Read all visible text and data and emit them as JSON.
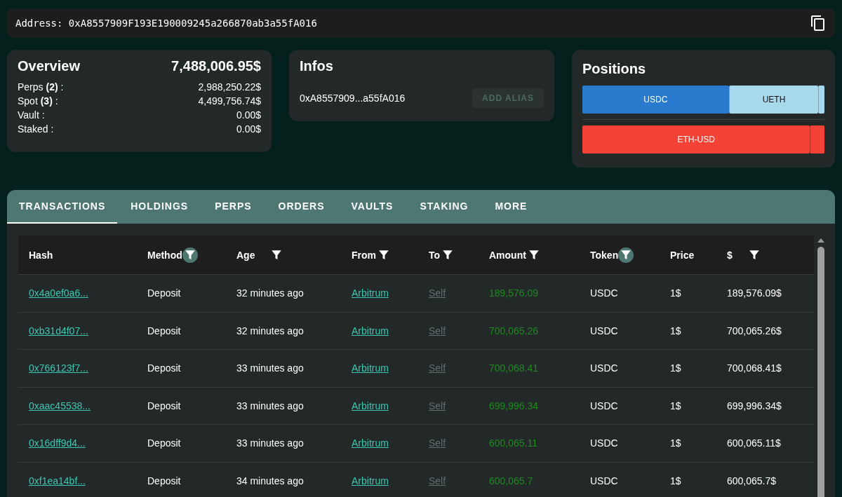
{
  "address_bar": {
    "label": "Address:",
    "value": "0xA8557909F193E190009245a266870ab3a55fA016"
  },
  "overview": {
    "title": "Overview",
    "total": "7,488,006.95$",
    "lines": [
      {
        "label": "Perps **(2)** :",
        "value": "2,988,250.22$"
      },
      {
        "label": "Spot **(3)** :",
        "value": "4,499,756.74$"
      },
      {
        "label": "Vault :",
        "value": "0.00$"
      },
      {
        "label": "Staked :",
        "value": "0.00$"
      }
    ]
  },
  "infos": {
    "title": "Infos",
    "address": "0xA8557909...a55fA016",
    "button": {
      "label": "ADD ALIAS",
      "disabled": true
    }
  },
  "positions": {
    "title": "Positions",
    "bars": [
      {
        "segments": [
          {
            "label": "USDC",
            "color": "#2979cc"
          },
          {
            "label": "UETH",
            "color": "#a8d8ec"
          },
          {
            "color": "#a8d8ec"
          }
        ]
      },
      {
        "segments": [
          {
            "label": "ETH-USD",
            "color": "#f44336"
          },
          {
            "color": "#f44336"
          }
        ]
      }
    ]
  },
  "tabs": [
    {
      "label": "TRANSACTIONS",
      "selected": true
    },
    {
      "label": "HOLDINGS",
      "selected": false
    },
    {
      "label": "PERPS",
      "selected": false
    },
    {
      "label": "ORDERS",
      "selected": false
    },
    {
      "label": "VAULTS",
      "selected": false
    },
    {
      "label": "STAKING",
      "selected": false
    },
    {
      "label": "MORE",
      "selected": false
    }
  ],
  "table": {
    "columns": [
      {
        "label": "Hash"
      },
      {
        "label": "Method",
        "filter": {
          "active": true
        }
      },
      {
        "label": "Age",
        "filter": {
          "active": false
        }
      },
      {
        "label": "From",
        "filter": {
          "active": false
        }
      },
      {
        "label": "To",
        "filter": {
          "active": false
        }
      },
      {
        "label": "Amount",
        "filter": {
          "active": false
        }
      },
      {
        "label": "Token",
        "filter": {
          "active": true
        }
      },
      {
        "label": "Price"
      },
      {
        "label": "$",
        "filter": {
          "active": false
        }
      }
    ],
    "rows": [
      [
        "0x4a0ef0a6...",
        "Deposit",
        "32 minutes ago",
        "Arbitrum",
        "Self",
        "189,576.09",
        "USDC",
        "1$",
        "189,576.09$"
      ],
      [
        "0xb31d4f07...",
        "Deposit",
        "32 minutes ago",
        "Arbitrum",
        "Self",
        "700,065.26",
        "USDC",
        "1$",
        "700,065.26$"
      ],
      [
        "0x766123f7...",
        "Deposit",
        "33 minutes ago",
        "Arbitrum",
        "Self",
        "700,068.41",
        "USDC",
        "1$",
        "700,068.41$"
      ],
      [
        "0xaac45538...",
        "Deposit",
        "33 minutes ago",
        "Arbitrum",
        "Self",
        "699,996.34",
        "USDC",
        "1$",
        "699,996.34$"
      ],
      [
        "0x16dff9d4...",
        "Deposit",
        "33 minutes ago",
        "Arbitrum",
        "Self",
        "600,065.11",
        "USDC",
        "1$",
        "600,065.11$"
      ],
      [
        "0xf1ea14bf...",
        "Deposit",
        "34 minutes ago",
        "Arbitrum",
        "Self",
        "600,065.7",
        "USDC",
        "1$",
        "600,065.7$"
      ]
    ]
  }
}
